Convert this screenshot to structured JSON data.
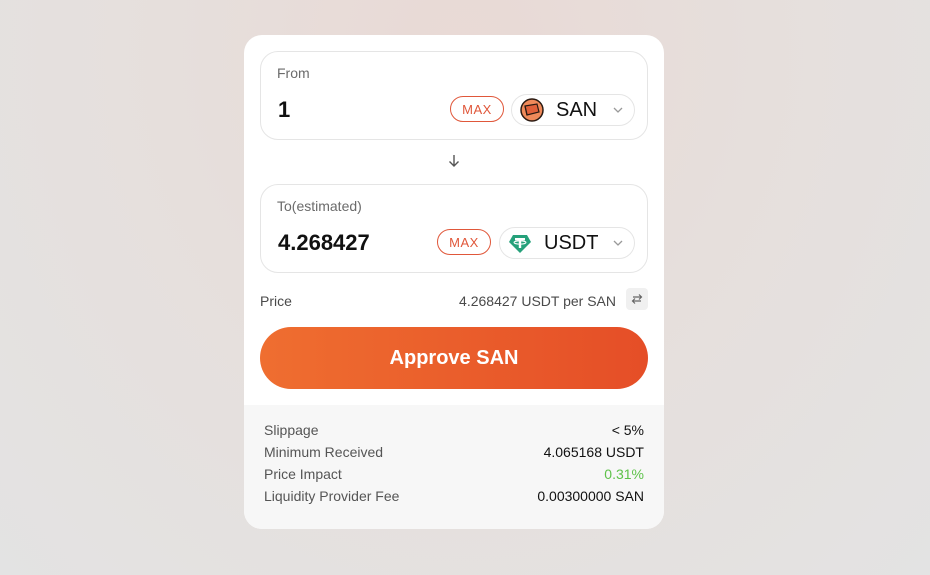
{
  "from": {
    "label": "From",
    "amount": "1",
    "max_label": "MAX",
    "token": {
      "symbol": "SAN",
      "icon": "san-token-icon"
    }
  },
  "to": {
    "label": "To(estimated)",
    "amount": "4.268427",
    "max_label": "MAX",
    "token": {
      "symbol": "USDT",
      "icon": "tether-usdt-icon"
    }
  },
  "price": {
    "label": "Price",
    "value": "4.268427 USDT per SAN"
  },
  "approve_label": "Approve SAN",
  "details": {
    "slippage": {
      "label": "Slippage",
      "value": "< 5%"
    },
    "minimum_received": {
      "label": "Minimum Received",
      "value": "4.065168 USDT"
    },
    "price_impact": {
      "label": "Price Impact",
      "value": "0.31%",
      "color": "#5ec24a"
    },
    "lp_fee": {
      "label": "Liquidity Provider Fee",
      "value": "0.00300000 SAN"
    }
  },
  "colors": {
    "accent": "#e0573a",
    "button_gradient_start": "#ef6e30",
    "button_gradient_end": "#e54e27",
    "usdt_green": "#26a17b"
  }
}
